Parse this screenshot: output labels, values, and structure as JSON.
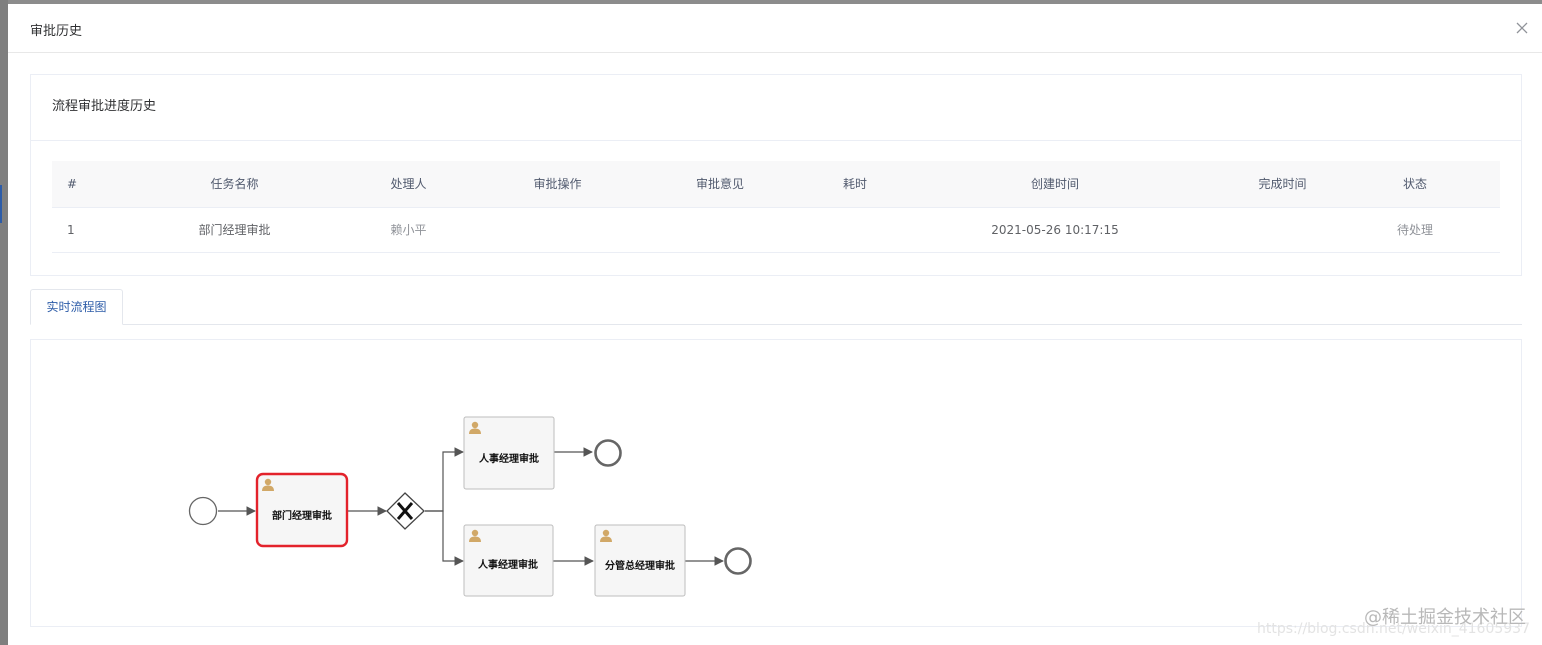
{
  "dialog": {
    "title": "审批历史",
    "close_icon": "close-icon"
  },
  "history_card": {
    "title": "流程审批进度历史",
    "columns": [
      "#",
      "任务名称",
      "处理人",
      "审批操作",
      "审批意见",
      "耗时",
      "创建时间",
      "完成时间",
      "状态"
    ],
    "rows": [
      {
        "index": "1",
        "task_name": "部门经理审批",
        "handler": "赖小平",
        "action": "",
        "opinion": "",
        "duration": "",
        "created_at": "2021-05-26 10:17:15",
        "completed_at": "",
        "status": "待处理"
      }
    ]
  },
  "tabs": [
    {
      "label": "实时流程图",
      "active": true
    }
  ],
  "flow_diagram": {
    "nodes": [
      {
        "id": "start",
        "type": "start-event"
      },
      {
        "id": "dept",
        "type": "user-task",
        "label": "部门经理审批",
        "active": true
      },
      {
        "id": "gateway",
        "type": "exclusive-gateway"
      },
      {
        "id": "hr1",
        "type": "user-task",
        "label": "人事经理审批"
      },
      {
        "id": "end1",
        "type": "end-event"
      },
      {
        "id": "hr2",
        "type": "user-task",
        "label": "人事经理审批"
      },
      {
        "id": "gm",
        "type": "user-task",
        "label": "分管总经理审批"
      },
      {
        "id": "end2",
        "type": "end-event"
      }
    ],
    "active_color": "#e3222b",
    "user_icon": "user-icon"
  },
  "watermark": {
    "text": "@稀土掘金技术社区",
    "url_text": "https://blog.csdn.net/weixin_41605937"
  }
}
